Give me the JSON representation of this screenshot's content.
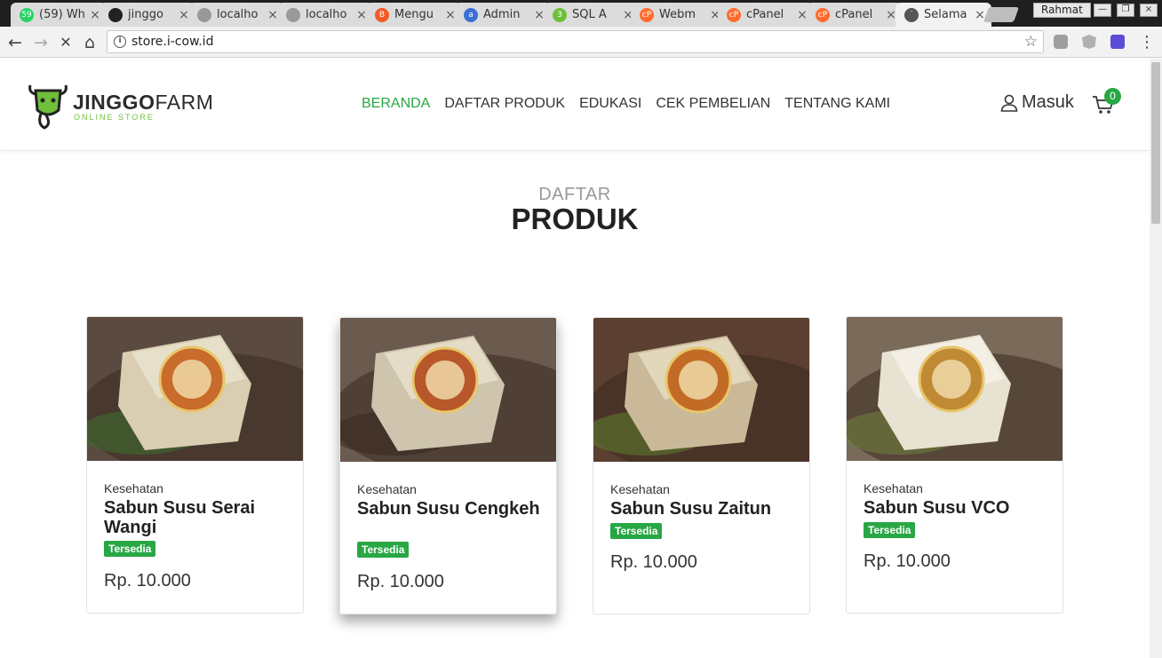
{
  "browser": {
    "tabs": [
      {
        "title": "(59) Wh",
        "favicon_color": "#25d366",
        "favicon_glyph": "59"
      },
      {
        "title": "jinggo",
        "favicon_color": "#222222",
        "favicon_glyph": ""
      },
      {
        "title": "localho",
        "favicon_color": "#999999",
        "favicon_glyph": ""
      },
      {
        "title": "localho",
        "favicon_color": "#999999",
        "favicon_glyph": ""
      },
      {
        "title": "Mengu",
        "favicon_color": "#f25a26",
        "favicon_glyph": "B"
      },
      {
        "title": "Admin",
        "favicon_color": "#3b6fd6",
        "favicon_glyph": "a"
      },
      {
        "title": "SQL A",
        "favicon_color": "#6fbf3b",
        "favicon_glyph": "3"
      },
      {
        "title": "Webm",
        "favicon_color": "#ff6c2c",
        "favicon_glyph": "cP"
      },
      {
        "title": "cPanel",
        "favicon_color": "#ff6c2c",
        "favicon_glyph": "cP"
      },
      {
        "title": "cPanel",
        "favicon_color": "#ff6c2c",
        "favicon_glyph": "cP"
      },
      {
        "title": "Selama",
        "favicon_color": "#555555",
        "favicon_glyph": "˙"
      }
    ],
    "close_glyph": "×",
    "profile_name": "Rahmat",
    "window_buttons": [
      "—",
      "❐",
      "×"
    ],
    "url": "store.i-cow.id",
    "info_glyph": "i",
    "star_glyph": "☆",
    "back_glyph": "←",
    "forward_glyph": "→",
    "stop_glyph": "✕",
    "home_glyph": "⌂",
    "menu_glyph": "⋮"
  },
  "site": {
    "brand": {
      "bold": "JINGGO",
      "light": "FARM",
      "tagline": "ONLINE STORE"
    },
    "nav": [
      "BERANDA",
      "DAFTAR PRODUK",
      "EDUKASI",
      "CEK PEMBELIAN",
      "TENTANG KAMI"
    ],
    "active_nav_index": 0,
    "login_label": "Masuk",
    "cart_count": "0",
    "accent_color": "#28a745",
    "section": {
      "kicker": "DAFTAR",
      "title": "PRODUK"
    },
    "products": [
      {
        "category": "Kesehatan",
        "name": "Sabun Susu Serai Wangi",
        "status": "Tersedia",
        "price": "Rp. 10.000"
      },
      {
        "category": "Kesehatan",
        "name": "Sabun Susu Cengkeh",
        "status": "Tersedia",
        "price": "Rp. 10.000"
      },
      {
        "category": "Kesehatan",
        "name": "Sabun Susu Zaitun",
        "status": "Tersedia",
        "price": "Rp. 10.000"
      },
      {
        "category": "Kesehatan",
        "name": "Sabun Susu VCO",
        "status": "Tersedia",
        "price": "Rp. 10.000"
      }
    ]
  }
}
